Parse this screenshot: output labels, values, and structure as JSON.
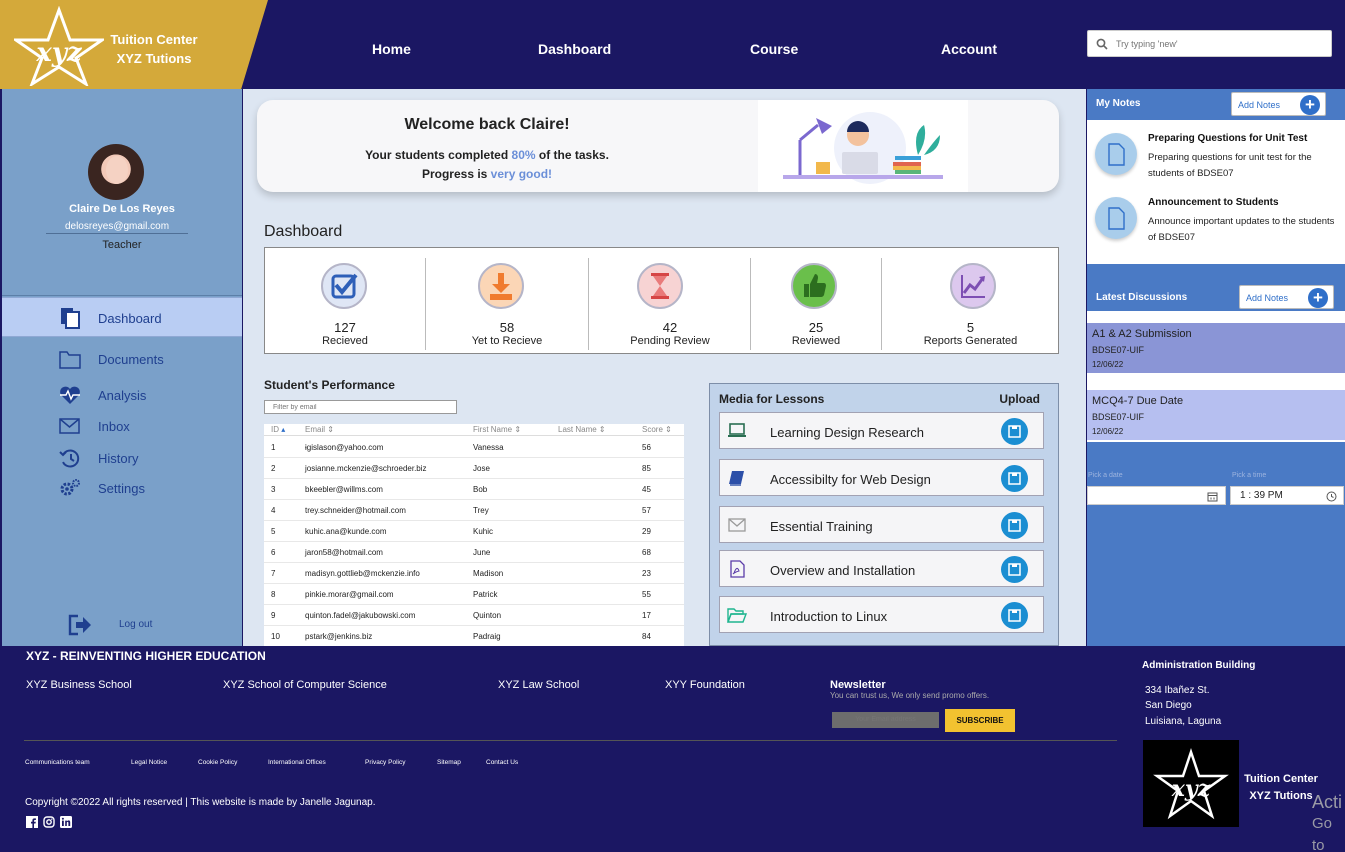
{
  "brand": {
    "line1": "Tuition Center",
    "line2": "XYZ Tutions"
  },
  "nav": [
    "Home",
    "Dashboard",
    "Course",
    "Account"
  ],
  "search": {
    "placeholder": "Try typing 'new'"
  },
  "profile": {
    "name": "Claire De Los Reyes",
    "email": "delosreyes@gmail.com",
    "role": "Teacher"
  },
  "sidebar": {
    "items": [
      {
        "label": "Dashboard",
        "icon": "document-stack-icon",
        "active": true
      },
      {
        "label": "Documents",
        "icon": "folder-icon"
      },
      {
        "label": "Analysis",
        "icon": "heart-pulse-icon"
      },
      {
        "label": "Inbox",
        "icon": "envelope-icon"
      },
      {
        "label": "History",
        "icon": "history-icon"
      },
      {
        "label": "Settings",
        "icon": "gears-icon"
      }
    ],
    "logout": "Log out"
  },
  "welcome": {
    "title": "Welcome back Claire!",
    "line1_pre": "Your students completed ",
    "line1_pct": "80%",
    "line1_post": " of the tasks.",
    "line2_pre": "Progress is ",
    "line2_hl": "very good!"
  },
  "dashboard": {
    "title": "Dashboard",
    "stats": [
      {
        "value": "127",
        "label": "Recieved",
        "icon": "checkbox-icon",
        "color": "#dfe6f5"
      },
      {
        "value": "58",
        "label": "Yet to Recieve",
        "icon": "download-tray-icon",
        "color": "#fbd6b6"
      },
      {
        "value": "42",
        "label": "Pending Review",
        "icon": "hourglass-icon",
        "color": "#f7d3d3"
      },
      {
        "value": "25",
        "label": "Reviewed",
        "icon": "thumbs-up-icon",
        "color": "#6abf4b"
      },
      {
        "value": "5",
        "label": "Reports Generated",
        "icon": "trend-chart-icon",
        "color": "#dcc8ee"
      }
    ]
  },
  "performance": {
    "title": "Student's Performance",
    "filter_placeholder": "Filter by email",
    "columns": [
      "ID",
      "Email",
      "First Name",
      "Last Name",
      "Score"
    ],
    "rows": [
      [
        "1",
        "ɨgislason@yahoo.com",
        "Vanessa",
        "",
        "56"
      ],
      [
        "2",
        "josianne.mckenzie@schroeder.biz",
        "Jose",
        "",
        "85"
      ],
      [
        "3",
        "bkeebler@willms.com",
        "Bob",
        "",
        "45"
      ],
      [
        "4",
        "trey.schneider@hotmail.com",
        "Trey",
        "",
        "57"
      ],
      [
        "5",
        "kuhic.ana@kunde.com",
        "Kuhic",
        "",
        "29"
      ],
      [
        "6",
        "jaron58@hotmail.com",
        "June",
        "",
        "68"
      ],
      [
        "7",
        "madisyn.gottlieb@mckenzie.info",
        "Madison",
        "",
        "23"
      ],
      [
        "8",
        "pinkie.morar@gmail.com",
        "Patrick",
        "",
        "55"
      ],
      [
        "9",
        "quinton.fadel@jakubowski.com",
        "Quinton",
        "",
        "17"
      ],
      [
        "10",
        "pstark@jenkins.biz",
        "Padraig",
        "",
        "84"
      ]
    ]
  },
  "media": {
    "title": "Media for Lessons",
    "upload": "Upload",
    "items": [
      {
        "label": "Learning Design Research",
        "icon": "laptop-icon"
      },
      {
        "label": "Accessibilty for Web Design",
        "icon": "book-icon"
      },
      {
        "label": "Essential Training",
        "icon": "envelope-icon"
      },
      {
        "label": "Overview and Installation",
        "icon": "pdf-icon"
      },
      {
        "label": "Introduction to Linux",
        "icon": "folder-open-icon"
      }
    ]
  },
  "notes": {
    "title": "My Notes",
    "add": "Add Notes",
    "items": [
      {
        "title": "Preparing Questions for Unit Test",
        "desc": "Preparing questions for unit test for the students of BDSE07"
      },
      {
        "title": "Announcement to Students",
        "desc": "Announce important updates to the students of BDSE07"
      }
    ]
  },
  "discussions": {
    "title": "Latest Discussions",
    "add": "Add Notes",
    "items": [
      {
        "title": "A1 & A2 Submission",
        "code": "BDSE07-UIF",
        "date": "12/06/22",
        "color": "#8a95d6"
      },
      {
        "title": "MCQ4-7 Due Date",
        "code": "BDSE07-UIF",
        "date": "12/06/22",
        "color": "#b6bff0"
      }
    ]
  },
  "pickers": {
    "date_label": "Pick a date",
    "time_label": "Pick a time",
    "time_value": "1 : 39 PM"
  },
  "footer": {
    "heading": "XYZ - REINVENTING HIGHER EDUCATION",
    "links": [
      "XYZ Business School",
      "XYZ School of Computer Science",
      "XYZ Law School",
      "XYY Foundation"
    ],
    "newsletter": {
      "title": "Newsletter",
      "sub": "You can trust us, We only send promo offers.",
      "placeholder": "Your Email address",
      "button": "SUBSCRIBE"
    },
    "small_links": [
      "Communications team",
      "Legal Notice",
      "Cookie Policy",
      "International Offices",
      "Privacy Policy",
      "Sitemap",
      "Contact Us"
    ],
    "copyright": "Copyright ©2022 All rights reserved | This website is made by Janelle Jagunap.",
    "social": [
      "facebook-icon",
      "instagram-icon",
      "linkedin-icon"
    ],
    "admin": {
      "title": "Administration Building",
      "lines": [
        "334 Ibañez St.",
        "San Diego",
        "Luisiana, Laguna"
      ]
    },
    "logo_line1": "Tuition Center",
    "logo_line2": "XYZ Tutions",
    "watermark": [
      "Acti",
      "Go to"
    ]
  }
}
